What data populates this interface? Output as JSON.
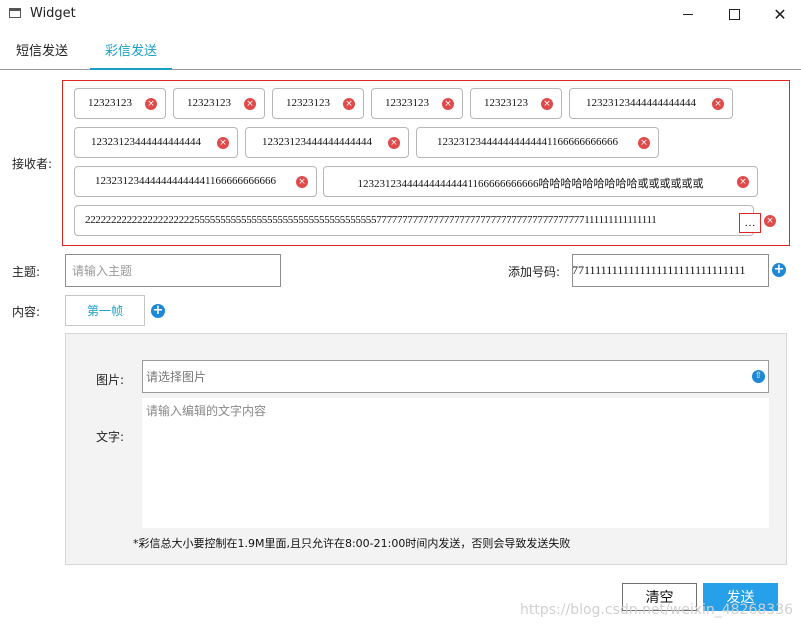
{
  "window": {
    "title": "Widget",
    "close_glyph": "✕"
  },
  "tabs": [
    {
      "label": "短信发送",
      "active": false
    },
    {
      "label": "彩信发送",
      "active": true
    }
  ],
  "recipients": {
    "label": "接收者:",
    "chips": [
      "12323123",
      "12323123",
      "12323123",
      "12323123",
      "12323123",
      "12323123444444444444",
      "12323123444444444444",
      "12323123444444444444",
      "123231234444444444441166666666666",
      "123231234444444444441166666666666",
      "123231234444444444441166666666666哈哈哈哈哈哈哈哈哈或或或或或或",
      "222222222222222222222555555555555555555555555555555555557777777777777777777777777777777777777777111111111111111"
    ],
    "ellipsis": "…",
    "remove_glyph": "×"
  },
  "subject": {
    "label": "主题:",
    "placeholder": "请输入主题"
  },
  "add_number": {
    "label": "添加号码:",
    "value": "7711111111111111111111111111111"
  },
  "content": {
    "label": "内容:",
    "frame_tab": "第一帧"
  },
  "image": {
    "label": "图片:",
    "placeholder": "请选择图片"
  },
  "text": {
    "label": "文字:",
    "placeholder": "请输入编辑的文字内容"
  },
  "notice": "*彩信总大小要控制在1.9M里面,且只允许在8:00-21:00时间内发送，否则会导致发送失败",
  "buttons": {
    "clear": "清空",
    "send": "发送"
  },
  "watermark": "https://blog.csdn.net/weixin_48268336",
  "icons": {
    "plus": "+",
    "upload": "⇧"
  },
  "colors": {
    "accent": "#1aa0c8",
    "error_border": "#e02525",
    "send_button": "#26a0e8"
  }
}
